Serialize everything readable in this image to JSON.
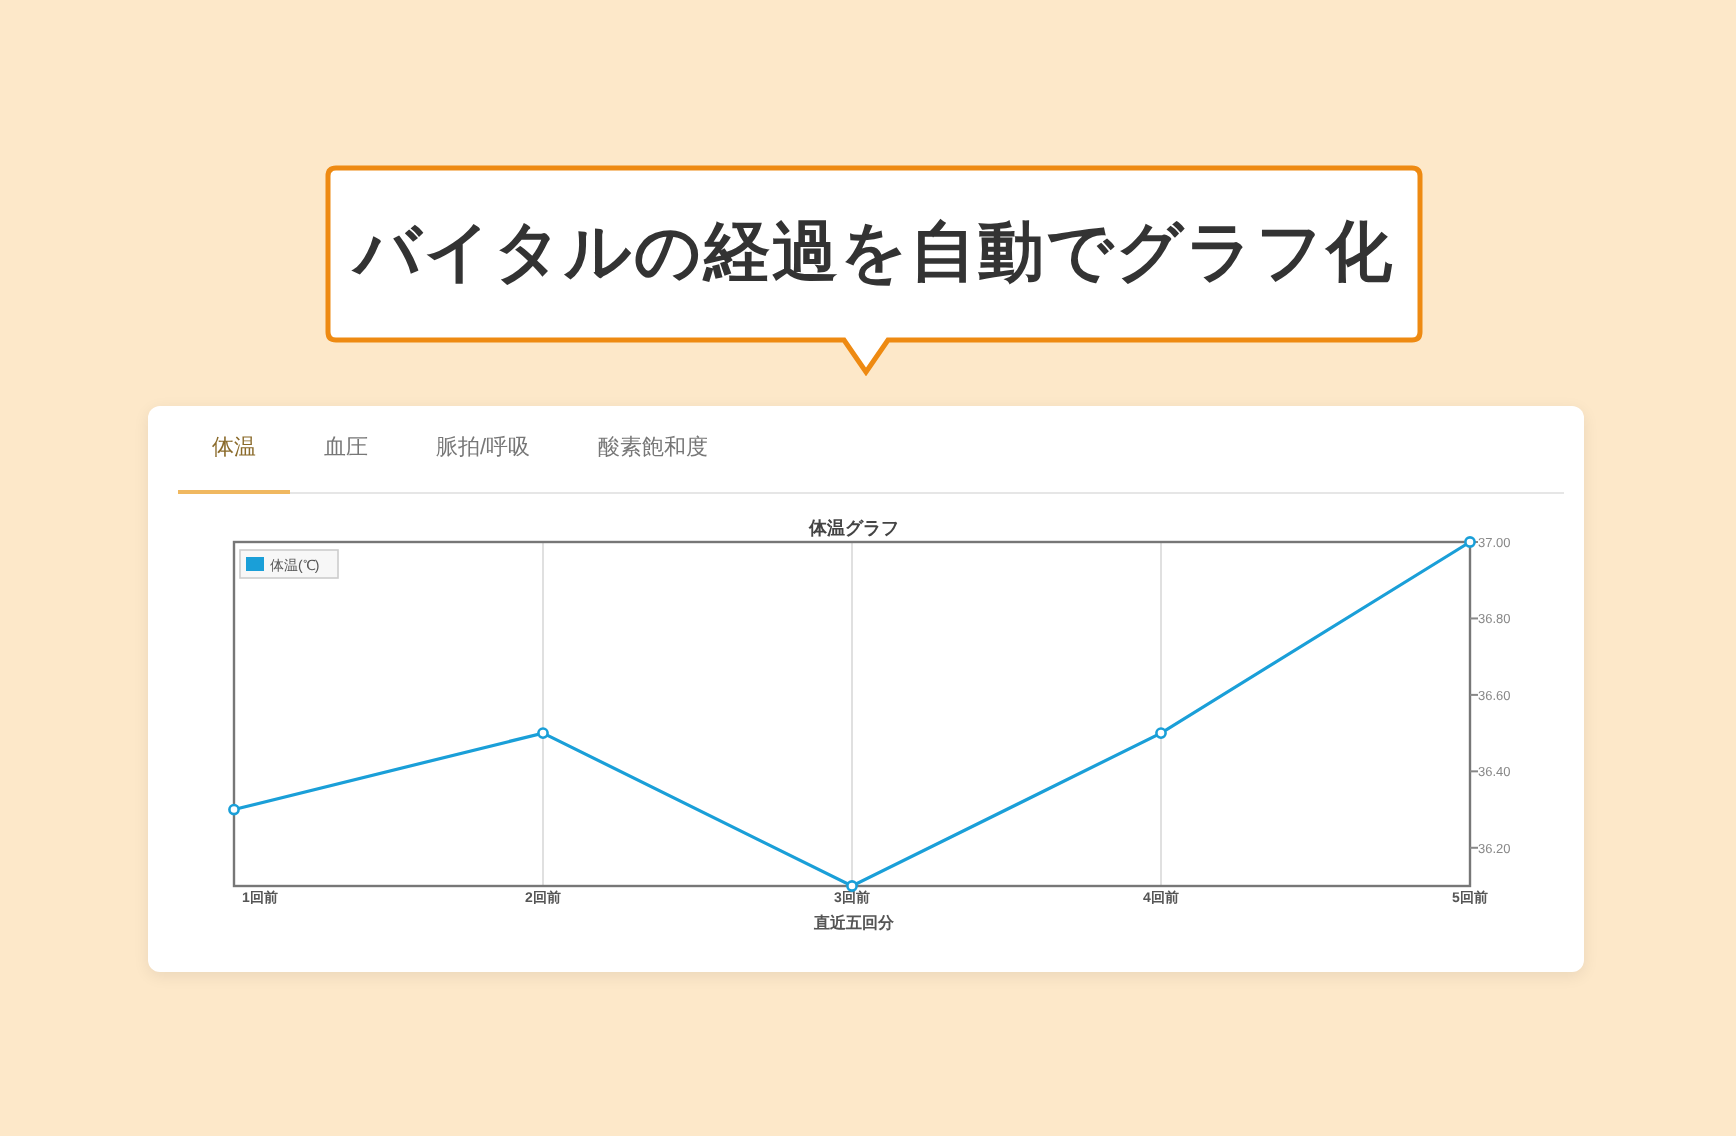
{
  "headline": "バイタルの経過を自動でグラフ化",
  "tabs": [
    {
      "label": "体温",
      "selected": true
    },
    {
      "label": "血圧",
      "selected": false
    },
    {
      "label": "脈拍/呼吸",
      "selected": false
    },
    {
      "label": "酸素飽和度",
      "selected": false
    }
  ],
  "chart": {
    "chart_data": {
      "type": "line",
      "title": "体温グラフ",
      "xlabel": "直近五回分",
      "categories": [
        "1回前",
        "2回前",
        "3回前",
        "4回前",
        "5回前"
      ],
      "grid": true,
      "series": [
        {
          "name": "体温(℃)",
          "color": "#1a9fd8",
          "marker": "circle",
          "values": [
            36.3,
            36.5,
            36.1,
            36.5,
            37.0
          ]
        }
      ],
      "ylim": [
        36.1,
        37.0
      ],
      "yticks": [
        {
          "value": 36.2,
          "label": "36.20"
        },
        {
          "value": 36.4,
          "label": "36.40"
        },
        {
          "value": 36.6,
          "label": "36.60"
        },
        {
          "value": 36.8,
          "label": "36.80"
        },
        {
          "value": 37.0,
          "label": "37.00"
        }
      ]
    }
  }
}
